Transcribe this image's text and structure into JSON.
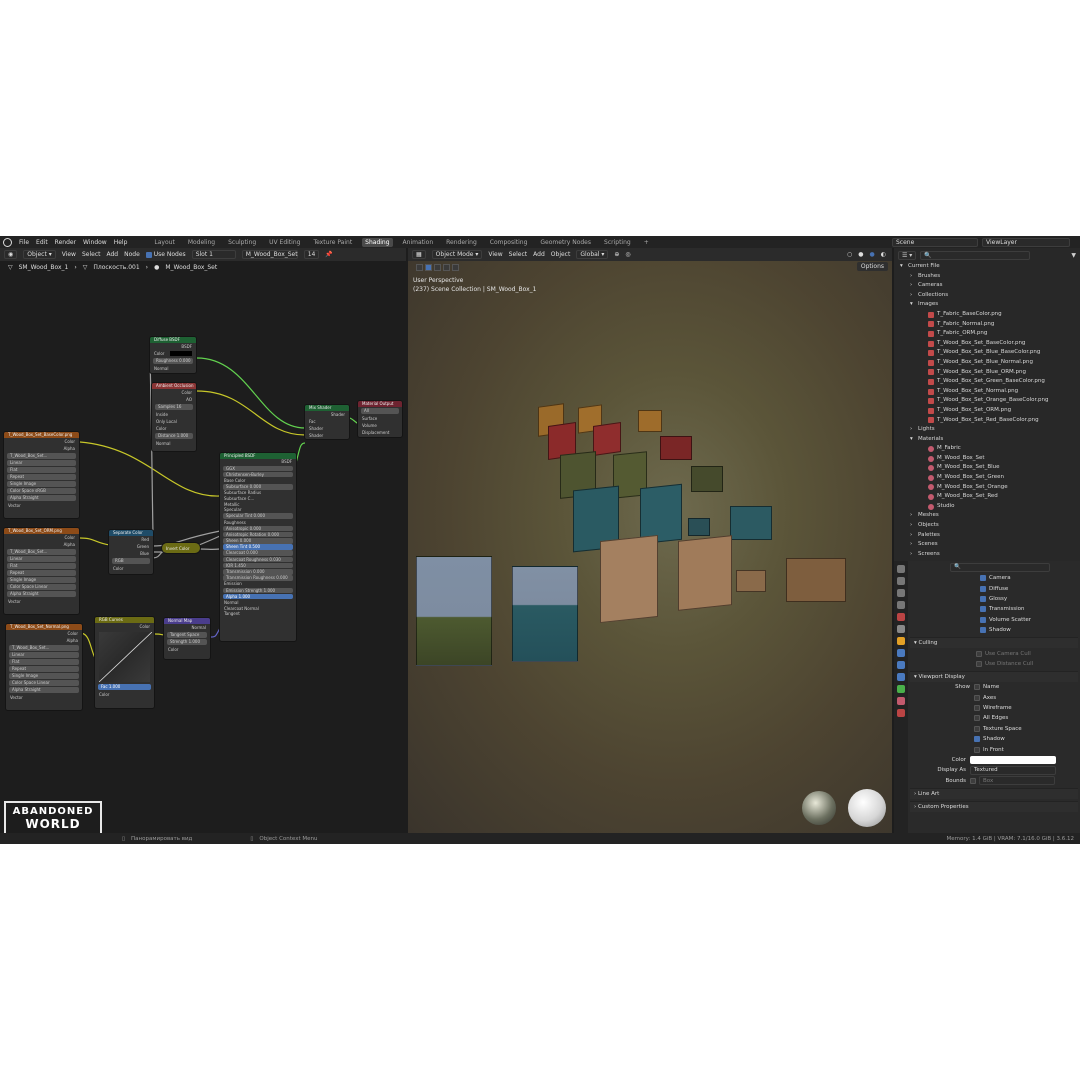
{
  "menu": {
    "items": [
      "File",
      "Edit",
      "Render",
      "Window",
      "Help"
    ],
    "workspaces": [
      "Layout",
      "Modeling",
      "Sculpting",
      "UV Editing",
      "Texture Paint",
      "Shading",
      "Animation",
      "Rendering",
      "Compositing",
      "Geometry Nodes",
      "Scripting",
      "+"
    ],
    "active_workspace": "Shading",
    "scene_label": "Scene",
    "view_layer_label": "ViewLayer"
  },
  "node_editor": {
    "mode": "Object",
    "menu": [
      "View",
      "Select",
      "Add",
      "Node"
    ],
    "use_nodes": "Use Nodes",
    "slot": "Slot 1",
    "material": "M_Wood_Box_Set",
    "users": "14",
    "breadcrumb": [
      "SM_Wood_Box_1",
      "Плоскость.001",
      "M_Wood_Box_Set"
    ],
    "nodes": {
      "diffuse": {
        "title": "Diffuse BSDF",
        "out": "BSDF",
        "rows": [
          "Color",
          "Roughness 0.000",
          "Normal"
        ]
      },
      "ao": {
        "title": "Ambient Occlusion",
        "out1": "Color",
        "out2": "AO",
        "rows": [
          "Samples 16",
          "Inside",
          "Only Local",
          "Color",
          "Distance 1.000",
          "Normal"
        ]
      },
      "mix": {
        "title": "Mix Shader",
        "out": "Shader",
        "rows": [
          "Fac",
          "Shader",
          "Shader"
        ]
      },
      "output": {
        "title": "Material Output",
        "target": "All",
        "rows": [
          "Surface",
          "Volume",
          "Displacement"
        ]
      },
      "img1": {
        "title": "T_Wood_Box_Set_BaseColor.png",
        "file": "T_Wood_Box_Set...",
        "rows": [
          "Linear",
          "Flat",
          "Repeat",
          "Single Image",
          "Color Space sRGB",
          "Alpha Straight",
          "Vector"
        ]
      },
      "img2": {
        "title": "T_Wood_Box_Set_ORM.png",
        "file": "T_Wood_Box_Set...",
        "rows": [
          "Linear",
          "Flat",
          "Repeat",
          "Single Image",
          "Color Space Linear",
          "Alpha Straight",
          "Vector"
        ]
      },
      "img3": {
        "title": "T_Wood_Box_Set_Normal.png",
        "file": "T_Wood_Box_Set...",
        "rows": [
          "Linear",
          "Flat",
          "Repeat",
          "Single Image",
          "Color Space Linear",
          "Alpha Straight",
          "Vector"
        ]
      },
      "sep": {
        "title": "Separate Color",
        "rows": [
          "Red",
          "Green",
          "Blue",
          "RGB",
          "Color"
        ]
      },
      "invert": {
        "title": "Invert Color"
      },
      "curves": {
        "title": "RGB Curves",
        "rows": [
          "Color",
          "Fac 1.000",
          "Color"
        ]
      },
      "normalmap": {
        "title": "Normal Map",
        "rows": [
          "Normal",
          "Tangent Space",
          "Strength 1.000",
          "Color"
        ]
      },
      "principled": {
        "title": "Principled BSDF",
        "out": "BSDF",
        "rows": [
          "GGX",
          "Christensen-Burley",
          "Base Color",
          "Subsurface 0.000",
          "Subsurface Radius",
          "Subsurface C...",
          "Metallic",
          "Specular",
          "Specular Tint 0.000",
          "Roughness",
          "Anisotropic 0.000",
          "Anisotropic Rotation 0.000",
          "Sheen 0.000",
          "Sheen Tint 0.500",
          "Clearcoat 0.000",
          "Clearcoat Roughness 0.030",
          "IOR 1.450",
          "Transmission 0.000",
          "Transmission Roughness 0.000",
          "Emission",
          "Emission Strength 1.000",
          "Alpha 1.000",
          "Normal",
          "Clearcoat Normal",
          "Tangent"
        ]
      }
    }
  },
  "viewport": {
    "mode": "Object Mode",
    "menu": [
      "View",
      "Select",
      "Add",
      "Object"
    ],
    "transform": "Global",
    "options": "Options",
    "title": "User Perspective",
    "subtitle": "(237) Scene Collection | SM_Wood_Box_1"
  },
  "outliner": {
    "rows": [
      {
        "label": "Current File",
        "indent": 0,
        "icon": ""
      },
      {
        "label": "Brushes",
        "indent": 1,
        "icon": ""
      },
      {
        "label": "Cameras",
        "indent": 1,
        "icon": ""
      },
      {
        "label": "Collections",
        "indent": 1,
        "icon": ""
      },
      {
        "label": "Images",
        "indent": 1,
        "icon": ""
      },
      {
        "label": "T_Fabric_BaseColor.png",
        "indent": 2,
        "icon": "img"
      },
      {
        "label": "T_Fabric_Normal.png",
        "indent": 2,
        "icon": "img"
      },
      {
        "label": "T_Fabric_ORM.png",
        "indent": 2,
        "icon": "img"
      },
      {
        "label": "T_Wood_Box_Set_BaseColor.png",
        "indent": 2,
        "icon": "img"
      },
      {
        "label": "T_Wood_Box_Set_Blue_BaseColor.png",
        "indent": 2,
        "icon": "img"
      },
      {
        "label": "T_Wood_Box_Set_Blue_Normal.png",
        "indent": 2,
        "icon": "img"
      },
      {
        "label": "T_Wood_Box_Set_Blue_ORM.png",
        "indent": 2,
        "icon": "img"
      },
      {
        "label": "T_Wood_Box_Set_Green_BaseColor.png",
        "indent": 2,
        "icon": "img"
      },
      {
        "label": "T_Wood_Box_Set_Normal.png",
        "indent": 2,
        "icon": "img"
      },
      {
        "label": "T_Wood_Box_Set_Orange_BaseColor.png",
        "indent": 2,
        "icon": "img"
      },
      {
        "label": "T_Wood_Box_Set_ORM.png",
        "indent": 2,
        "icon": "img"
      },
      {
        "label": "T_Wood_Box_Set_Red_BaseColor.png",
        "indent": 2,
        "icon": "img"
      },
      {
        "label": "Lights",
        "indent": 1,
        "icon": ""
      },
      {
        "label": "Materials",
        "indent": 1,
        "icon": ""
      },
      {
        "label": "M_Fabric",
        "indent": 2,
        "icon": "mat"
      },
      {
        "label": "M_Wood_Box_Set",
        "indent": 2,
        "icon": "mat"
      },
      {
        "label": "M_Wood_Box_Set_Blue",
        "indent": 2,
        "icon": "mat"
      },
      {
        "label": "M_Wood_Box_Set_Green",
        "indent": 2,
        "icon": "mat"
      },
      {
        "label": "M_Wood_Box_Set_Orange",
        "indent": 2,
        "icon": "mat"
      },
      {
        "label": "M_Wood_Box_Set_Red",
        "indent": 2,
        "icon": "mat"
      },
      {
        "label": "Studio",
        "indent": 2,
        "icon": "mat"
      },
      {
        "label": "Meshes",
        "indent": 1,
        "icon": ""
      },
      {
        "label": "Objects",
        "indent": 1,
        "icon": ""
      },
      {
        "label": "Palettes",
        "indent": 1,
        "icon": ""
      },
      {
        "label": "Scenes",
        "indent": 1,
        "icon": ""
      },
      {
        "label": "Screens",
        "indent": 1,
        "icon": ""
      }
    ]
  },
  "properties": {
    "visibility": [
      {
        "label": "Camera",
        "checked": true
      },
      {
        "label": "Diffuse",
        "checked": true
      },
      {
        "label": "Glossy",
        "checked": true
      },
      {
        "label": "Transmission",
        "checked": true
      },
      {
        "label": "Volume Scatter",
        "checked": true
      },
      {
        "label": "Shadow",
        "checked": true
      }
    ],
    "culling": {
      "title": "Culling",
      "rows": [
        "Use Camera Cull",
        "Use Distance Cull"
      ]
    },
    "viewport_display": {
      "title": "Viewport Display",
      "show_label": "Show",
      "rows": [
        {
          "label": "Name",
          "checked": false
        },
        {
          "label": "Axes",
          "checked": false
        },
        {
          "label": "Wireframe",
          "checked": false
        },
        {
          "label": "All Edges",
          "checked": false
        },
        {
          "label": "Texture Space",
          "checked": false
        },
        {
          "label": "Shadow",
          "checked": true
        },
        {
          "label": "In Front",
          "checked": false
        }
      ],
      "color_label": "Color",
      "display_as_label": "Display As",
      "display_as": "Textured",
      "bounds_label": "Bounds",
      "bounds": "Box"
    },
    "sections": [
      "Line Art",
      "Custom Properties"
    ]
  },
  "status": {
    "hint1": "Панорамировать вид",
    "hint2": "Object Context Menu",
    "memory": "Memory: 1.4 GiB | VRAM: 7.1/16.0 GiB | 3.6.12"
  },
  "logo": {
    "line1": "ABANDONED",
    "line2": "WORLD"
  }
}
